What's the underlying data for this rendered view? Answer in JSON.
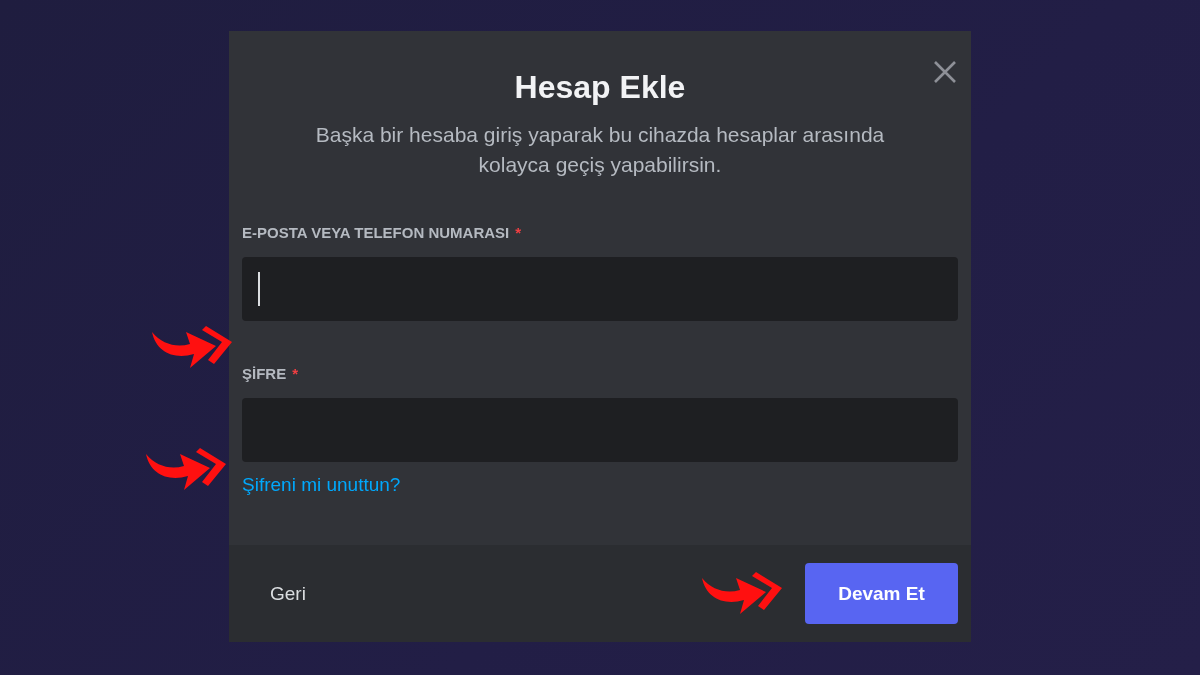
{
  "dialog": {
    "title": "Hesap Ekle",
    "subtitle": "Başka bir hesaba giriş yaparak bu cihazda hesaplar arasında kolayca geçiş yapabilirsin.",
    "fields": [
      {
        "label": "E-POSTA VEYA TELEFON NUMARASI",
        "required_mark": "*",
        "focused": true
      },
      {
        "label": "ŞİFRE",
        "required_mark": "*",
        "focused": false
      }
    ],
    "link": "Şifreni mi unuttun?",
    "footer": {
      "back": "Geri",
      "continue": "Devam Et"
    }
  }
}
